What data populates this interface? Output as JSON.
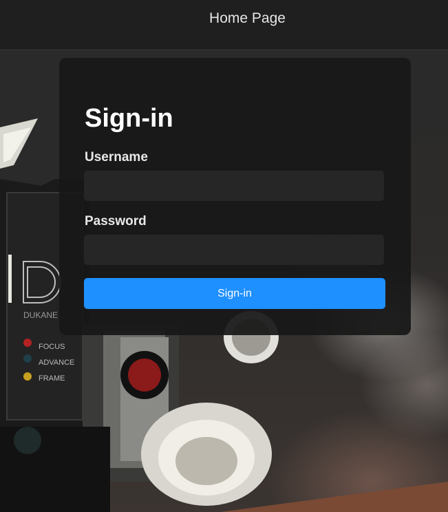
{
  "header": {
    "title": "Home Page"
  },
  "signin": {
    "title": "Sign-in",
    "username_label": "Username",
    "username_value": "",
    "password_label": "Password",
    "password_value": "",
    "submit_label": "Sign-in"
  },
  "background": {
    "projector_brand": "DUKANE",
    "projector_controls": [
      "FOCUS",
      "ADVANCE",
      "FRAME"
    ]
  },
  "colors": {
    "topbar": "#1f1f1f",
    "card": "#181818",
    "input": "#262626",
    "primary_button": "#1e90ff",
    "text": "#ffffff"
  }
}
